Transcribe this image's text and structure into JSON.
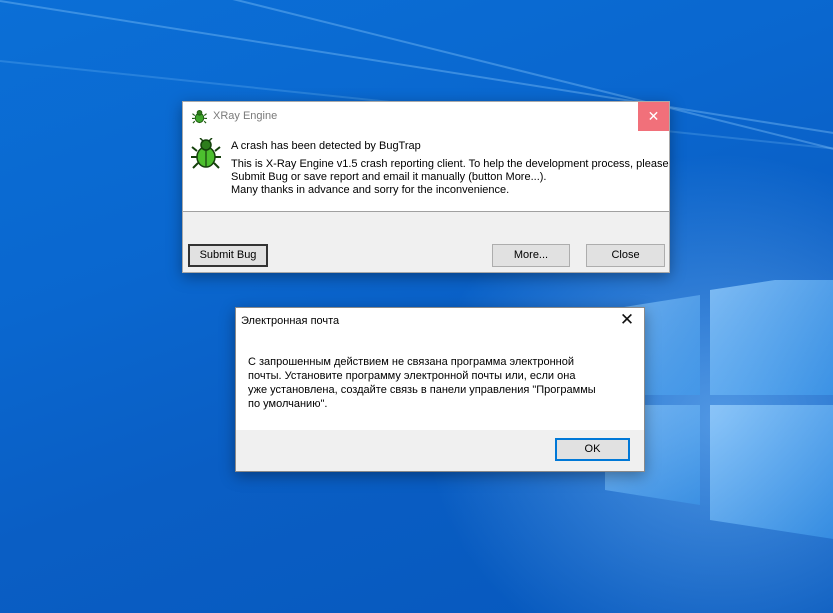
{
  "desktop": {
    "wallpaper": "windows-10-blue-logo"
  },
  "bugtrap_dialog": {
    "title": "XRay Engine",
    "title_icon": "bug-icon",
    "big_icon": "bug-icon",
    "headline": "A crash has been detected by BugTrap",
    "message_lines": [
      "This is X-Ray Engine v1.5 crash reporting client. To help the development process, please",
      "Submit Bug or save report and email it manually (button More...).",
      "Many thanks in advance and sorry for the inconvenience."
    ],
    "buttons": {
      "submit": "Submit Bug",
      "more": "More...",
      "close": "Close"
    },
    "close_glyph": "✕",
    "close_color": "#f1707a"
  },
  "mail_dialog": {
    "title": "Электронная почта",
    "close_glyph": "✕",
    "message_lines": [
      "С запрошенным действием не связана программа электронной",
      "почты. Установите программу электронной почты или, если она",
      "уже установлена, создайте связь в панели управления \"Программы",
      "по умолчанию\"."
    ],
    "ok_label": "OK",
    "accent": "#0078d7"
  }
}
